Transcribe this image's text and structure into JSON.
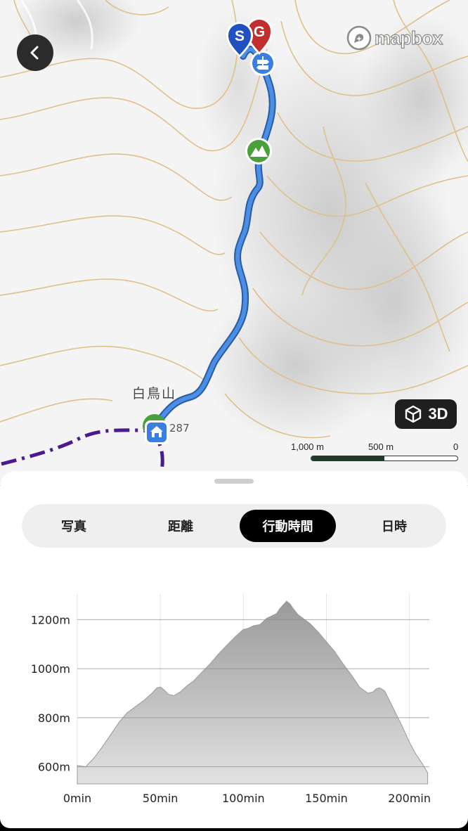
{
  "map": {
    "attribution_logo": "mapbox",
    "peak_name": "白鳥山",
    "peak_elevation": "287",
    "button_3d_label": "3D",
    "scale_labels": [
      "1,000 m",
      "500 m",
      "0"
    ],
    "route_color": "#4a8ee6",
    "trail_color": "#4b1a8c",
    "contour_color": "#e0c08a",
    "markers": {
      "start": "S",
      "goal": "G"
    }
  },
  "sheet": {
    "tabs": [
      {
        "label": "写真",
        "active": false
      },
      {
        "label": "距離",
        "active": false
      },
      {
        "label": "行動時間",
        "active": true
      },
      {
        "label": "日時",
        "active": false
      }
    ]
  },
  "chart_data": {
    "type": "area",
    "xlabel": "",
    "ylabel": "",
    "x_tick_labels": [
      "0min",
      "50min",
      "100min",
      "150min",
      "200min"
    ],
    "y_tick_labels": [
      "600m",
      "800m",
      "1000m",
      "1200m"
    ],
    "xlim": [
      0,
      212
    ],
    "ylim": [
      530,
      1290
    ],
    "grid": true,
    "fill_color": "#a9a9a9",
    "x": [
      0,
      5,
      10,
      15,
      20,
      25,
      30,
      35,
      40,
      45,
      48,
      50,
      52,
      55,
      58,
      62,
      66,
      70,
      75,
      80,
      85,
      90,
      95,
      98,
      100,
      103,
      106,
      110,
      114,
      117,
      120,
      122,
      124,
      126,
      128,
      130,
      133,
      136,
      140,
      145,
      150,
      155,
      160,
      165,
      170,
      175,
      178,
      180,
      182,
      185,
      188,
      192,
      196,
      200,
      204,
      208,
      211
    ],
    "y": [
      605,
      600,
      635,
      680,
      730,
      780,
      820,
      845,
      870,
      900,
      922,
      925,
      915,
      895,
      890,
      905,
      930,
      950,
      985,
      1020,
      1060,
      1095,
      1130,
      1148,
      1160,
      1165,
      1175,
      1180,
      1205,
      1215,
      1225,
      1245,
      1260,
      1275,
      1265,
      1245,
      1220,
      1205,
      1185,
      1150,
      1110,
      1070,
      1020,
      975,
      925,
      900,
      905,
      918,
      922,
      910,
      870,
      815,
      760,
      700,
      650,
      610,
      575
    ]
  }
}
